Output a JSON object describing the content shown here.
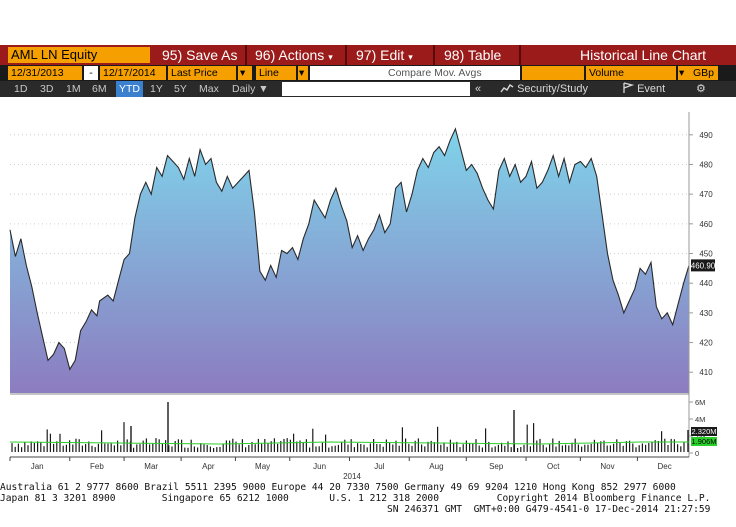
{
  "toolbar": {
    "ticker": "AML LN Equity",
    "save_as": "95) Save As",
    "actions": "96) Actions",
    "edit": "97) Edit",
    "table": "98) Table",
    "chart_title": "Historical Line Chart",
    "dropdown_glyph": "▾"
  },
  "fields": {
    "start_date": "12/31/2013",
    "date_separator": "-",
    "end_date": "12/17/2014",
    "price_field": "Last Price",
    "chart_style": "Line",
    "compare": "Compare Mov. Avgs",
    "volume": "Volume",
    "currency": "GBp",
    "field_arrow": "▾"
  },
  "ranges": {
    "items": [
      "1D",
      "3D",
      "1M",
      "6M",
      "YTD",
      "1Y",
      "5Y",
      "Max"
    ],
    "active": "YTD",
    "frequency": "Daily ▼"
  },
  "tools": {
    "collapse": "«",
    "security_study": "Security/Study",
    "event": "Event",
    "gear": "⚙"
  },
  "colors": {
    "area_top": "#7fd3ea",
    "area_bottom": "#8c7cc0",
    "header_red": "#9b1b1b",
    "field_orange": "#f5a000",
    "last_badge": "#1a1a1a",
    "volume_badge": "#2ad02a"
  },
  "chart_data": {
    "type": "area",
    "y_axis": {
      "ticks": [
        410,
        420,
        430,
        440,
        450,
        460,
        470,
        480,
        490
      ],
      "range": [
        403,
        496
      ],
      "position": "right"
    },
    "x_axis": {
      "tick_labels": [
        "Jan",
        "Feb",
        "Mar",
        "Apr",
        "May",
        "Jun",
        "Jul",
        "Aug",
        "Sep",
        "Oct",
        "Nov",
        "Dec"
      ],
      "year_label": "2014"
    },
    "last_value_label": "460.90",
    "series": [
      {
        "t": [
          0,
          2,
          4,
          6,
          8,
          10,
          12,
          14,
          16,
          18,
          20,
          22,
          24,
          26,
          28,
          30,
          32,
          33,
          36,
          38,
          40,
          42,
          44,
          46,
          48,
          50,
          52,
          54,
          56,
          58,
          60,
          62,
          64,
          66,
          68,
          70,
          72,
          74,
          76,
          78,
          80,
          82,
          84,
          86,
          88,
          90,
          92,
          94,
          96,
          98,
          100,
          102,
          104,
          106,
          108,
          110,
          112,
          114,
          116,
          118,
          120,
          122,
          124,
          126,
          128,
          130,
          132,
          134,
          136,
          138,
          140,
          142,
          144,
          146,
          148,
          150,
          152,
          154,
          156,
          158,
          160,
          162,
          164,
          166,
          168,
          170,
          172,
          174,
          176,
          178,
          180,
          182,
          184,
          186,
          188,
          190,
          192,
          194,
          196,
          198,
          200,
          202,
          204,
          206,
          208,
          210,
          212,
          214,
          216,
          218,
          220,
          222,
          224,
          226,
          228,
          230,
          232,
          234,
          236,
          238,
          240,
          242,
          244,
          246,
          248,
          250
        ],
        "values": [
          458,
          449,
          455,
          446,
          439,
          430,
          422,
          414,
          416,
          420,
          418,
          411,
          414,
          424,
          427,
          431,
          429,
          434,
          436,
          434,
          441,
          448,
          450,
          462,
          470,
          474,
          470,
          479,
          476,
          483,
          481,
          479,
          475,
          482,
          476,
          485,
          480,
          482,
          474,
          471,
          476,
          472,
          474,
          476,
          478,
          464,
          444,
          441,
          446,
          442,
          451,
          450,
          452,
          448,
          455,
          460,
          468,
          465,
          462,
          468,
          472,
          466,
          461,
          452,
          456,
          451,
          455,
          458,
          463,
          457,
          460,
          472,
          474,
          464,
          470,
          478,
          482,
          479,
          484,
          486,
          483,
          488,
          492,
          485,
          478,
          480,
          477,
          472,
          468,
          465,
          478,
          482,
          476,
          480,
          474,
          476,
          481,
          472,
          474,
          478,
          483,
          476,
          482,
          474,
          480,
          481,
          479,
          482,
          476,
          463,
          450,
          441,
          436,
          430,
          434,
          438,
          445,
          443,
          447,
          432,
          428,
          430,
          426,
          433,
          440,
          446,
          443,
          438,
          440,
          444,
          440,
          448,
          443,
          440,
          437,
          430,
          428,
          434,
          432,
          431,
          433,
          434,
          429,
          427,
          432,
          434,
          431,
          433,
          429,
          432,
          436,
          438,
          433,
          428,
          429,
          430,
          431,
          427,
          431,
          434,
          431,
          436,
          438,
          439,
          440,
          444,
          441,
          440,
          445,
          449,
          452,
          450,
          446,
          444,
          449,
          453,
          448,
          447,
          450,
          445,
          442,
          449,
          451,
          447,
          446,
          442,
          438,
          434,
          432,
          436,
          440,
          436,
          438,
          443,
          440,
          441,
          442,
          444,
          446,
          448,
          450,
          452,
          448,
          443,
          440,
          436,
          449,
          460.9
        ]
      }
    ],
    "volume": {
      "ticks": [
        "6M",
        "4M",
        "2M",
        "0"
      ],
      "last_value_label": "1.906M",
      "current_label": "2.320M"
    }
  },
  "footer": {
    "line1": "Australia 61 2 9777 8600 Brazil 5511 2395 9000 Europe 44 20 7330 7500 Germany 49 69 9204 1210 Hong Kong 852 2977 6000",
    "line2": "Japan 81 3 3201 8900        Singapore 65 6212 1000       U.S. 1 212 318 2000          Copyright 2014 Bloomberg Finance L.P.",
    "line3": "                                                                   SN 246371 GMT  GMT+0:00 G479-4541-0 17-Dec-2014 21:27:59"
  }
}
